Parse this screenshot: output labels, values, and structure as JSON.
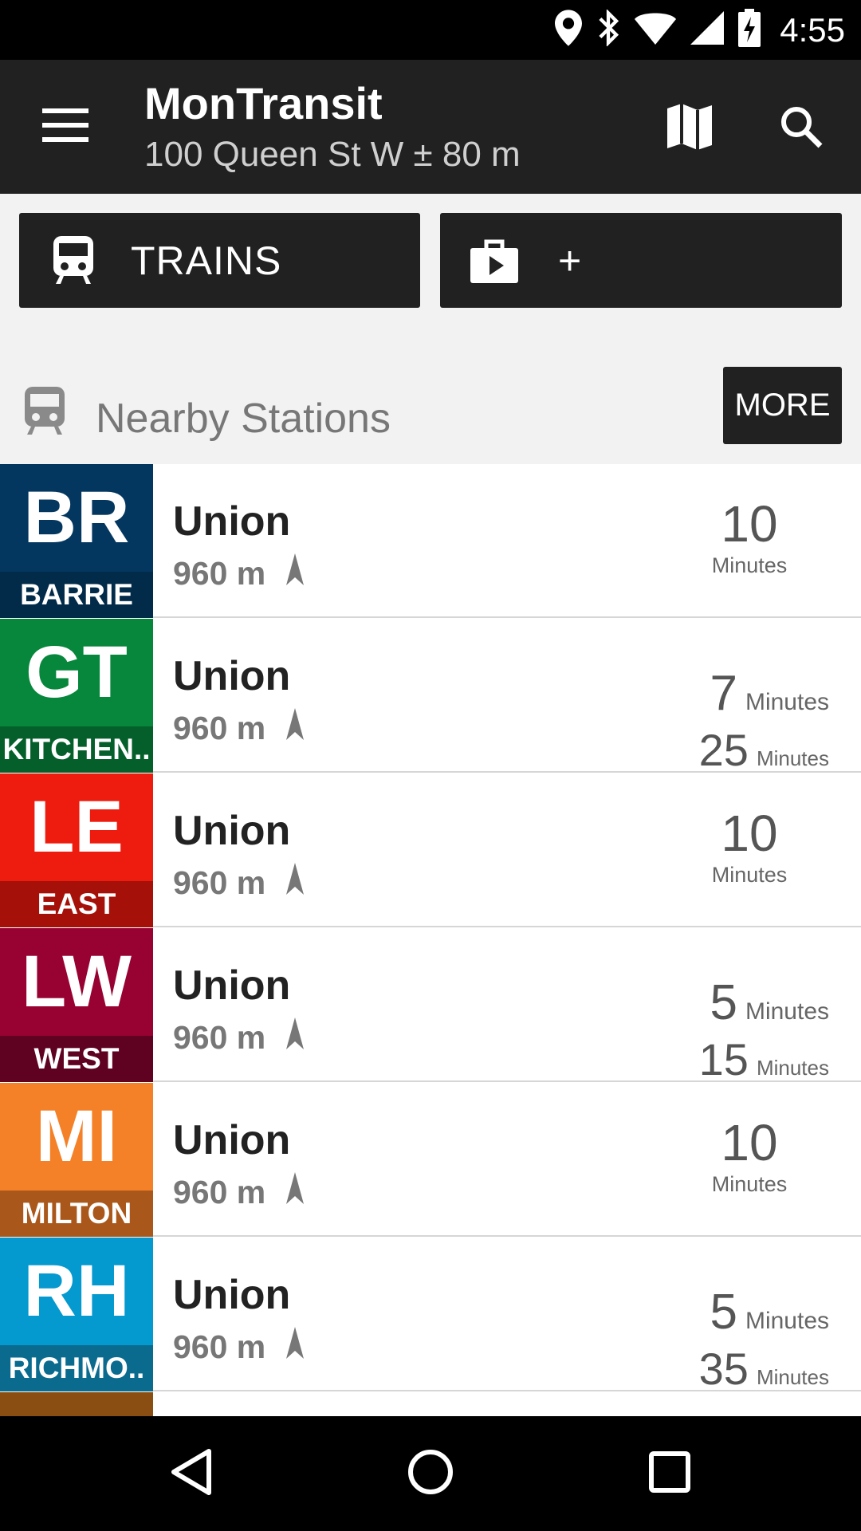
{
  "status_bar": {
    "time": "4:55"
  },
  "app_bar": {
    "title": "MonTransit",
    "subtitle": "100 Queen St W ± 80 m"
  },
  "filters": {
    "trains_label": "TRAINS",
    "add_label": "+"
  },
  "section": {
    "title": "Nearby Stations",
    "more_label": "MORE"
  },
  "stations": [
    {
      "code": "BR",
      "line": "BARRIE",
      "color": "#04375f",
      "dark": "#022a49",
      "name": "Union",
      "distance": "960 m",
      "times": [
        {
          "value": "10",
          "unit": "Minutes"
        }
      ]
    },
    {
      "code": "GT",
      "line": "KITCHEN..",
      "color": "#07873c",
      "dark": "#045f2a",
      "name": "Union",
      "distance": "960 m",
      "times": [
        {
          "value": "7",
          "unit": "Minutes"
        },
        {
          "value": "25",
          "unit": "Minutes"
        }
      ]
    },
    {
      "code": "LE",
      "line": "EAST",
      "color": "#ee1c0f",
      "dark": "#a51009",
      "name": "Union",
      "distance": "960 m",
      "times": [
        {
          "value": "10",
          "unit": "Minutes"
        }
      ]
    },
    {
      "code": "LW",
      "line": "WEST",
      "color": "#980233",
      "dark": "#5f0120",
      "name": "Union",
      "distance": "960 m",
      "times": [
        {
          "value": "5",
          "unit": "Minutes"
        },
        {
          "value": "15",
          "unit": "Minutes"
        }
      ]
    },
    {
      "code": "MI",
      "line": "MILTON",
      "color": "#f48127",
      "dark": "#a9571a",
      "name": "Union",
      "distance": "960 m",
      "times": [
        {
          "value": "10",
          "unit": "Minutes"
        }
      ]
    },
    {
      "code": "RH",
      "line": "RICHMO..",
      "color": "#0499cf",
      "dark": "#0a6b8f",
      "name": "Union",
      "distance": "960 m",
      "times": [
        {
          "value": "5",
          "unit": "Minutes"
        },
        {
          "value": "35",
          "unit": "Minutes"
        }
      ]
    }
  ]
}
